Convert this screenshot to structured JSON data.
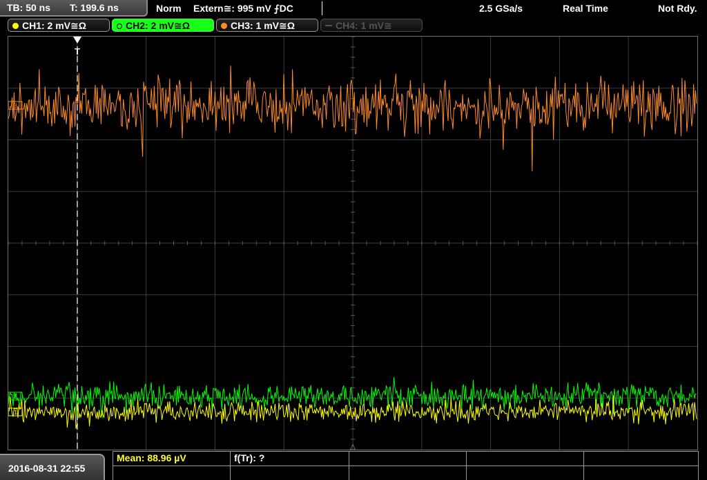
{
  "top": {
    "timebase": "TB: 50 ns",
    "trigger_time": "T: 199.6 ns",
    "mode": "Norm",
    "trigger_source": "Extern≅: 995 mV ⨍DC",
    "sample_rate": "2.5 GSa/s",
    "acq_mode": "Real Time",
    "status": "Not Rdy."
  },
  "channels": [
    {
      "label": "CH1: 2 mV≅Ω",
      "color": "#ffff00",
      "state": "normal"
    },
    {
      "label": "CH2: 2 mV≅Ω",
      "color": "#00ff00",
      "state": "active"
    },
    {
      "label": "CH3: 1 mV≅Ω",
      "color": "#ff8c28",
      "state": "normal"
    },
    {
      "label": "CH4: 1 mV≅",
      "color": "#555555",
      "state": "disabled"
    }
  ],
  "display": {
    "trigger_marker": "T",
    "ch3_level_label": "3",
    "ch2_level_label": "2",
    "ch1_level_label": "1",
    "trigger_point_marker": "△",
    "colors": {
      "grid": "#3c3c3c",
      "ch1": "#ffff00",
      "ch2": "#00ff00",
      "ch3": "#ff8c28",
      "trigger": "#ffffff"
    }
  },
  "bottom": {
    "datetime": "2016-08-31 22:55",
    "measurements": [
      {
        "label": "Mean: 88.96 µV",
        "kind": "mean"
      },
      {
        "label": "f(Tr): ?",
        "kind": "normal"
      }
    ]
  }
}
